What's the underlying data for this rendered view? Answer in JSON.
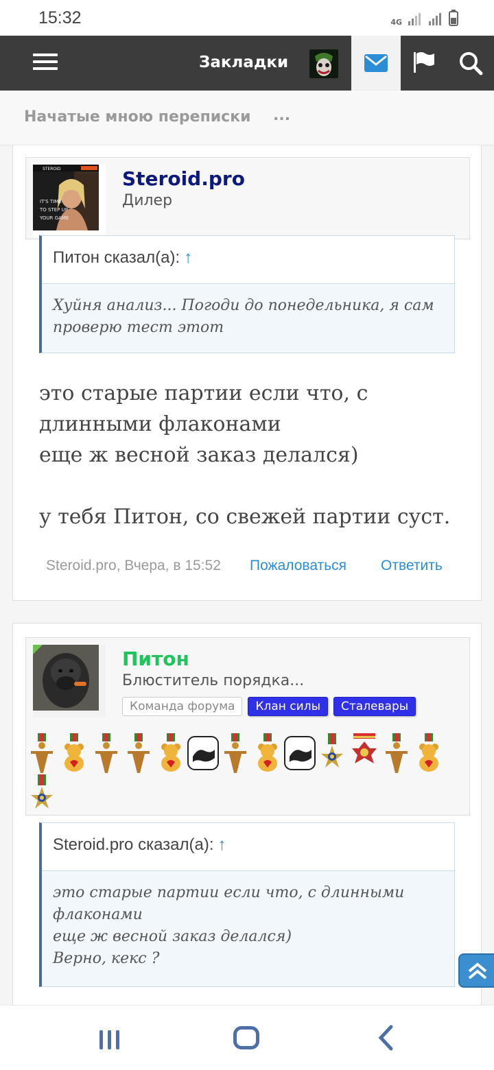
{
  "status": {
    "time": "15:32",
    "network": "4G"
  },
  "appbar": {
    "title": "Закладки"
  },
  "subbar": {
    "breadcrumb": "Начатые мною переписки",
    "more": "..."
  },
  "posts": [
    {
      "author": "Steroid.pro",
      "user_title": "Дилер",
      "avatar_text": [
        "STEROID",
        "IT'S TIME",
        "TO STEP UP",
        "YOUR GAME"
      ],
      "quote": {
        "header": "Питон сказал(а):",
        "arrow": "↑",
        "body": "Хуйня анализ... Погоди до понедельника, я сам проверю тест этот"
      },
      "message": [
        "это старые партии если что, с длинными флаконами\nеще ж весной заказ делался)",
        "у тебя Питон, со свежей партии суст."
      ],
      "footer": {
        "meta": "Steroid.pro, Вчера, в 15:52",
        "report": "Пожаловаться",
        "reply": "Ответить"
      }
    },
    {
      "author": "Питон",
      "user_title": "Блюститель порядка...",
      "badges": [
        "Команда форума",
        "Клан силы",
        "Сталевары"
      ],
      "medals": [
        "gold-figure",
        "teddy-bear",
        "gold-figure",
        "gold-figure",
        "teddy-bear",
        "handshake",
        "gold-figure",
        "teddy-bear",
        "handshake",
        "star-order",
        "eagle-cross",
        "gold-figure",
        "teddy-bear",
        "star-order"
      ],
      "quote": {
        "header": "Steroid.pro сказал(а):",
        "arrow": "↑",
        "body": "это старые партии если что, с длинными флаконами\nеще ж весной заказ делался)\nВерно, кекс ?"
      }
    }
  ],
  "colors": {
    "appbar": "#3c3c3c",
    "link": "#2b8dd6",
    "dealer_name": "#0d1a7c",
    "mod_name": "#1fc45a",
    "badge_blue": "#3030e8"
  }
}
